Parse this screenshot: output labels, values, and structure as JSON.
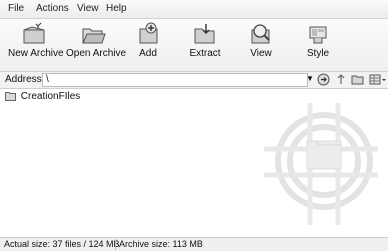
{
  "menu": [
    "File",
    "Actions",
    "View",
    "Help"
  ],
  "toolbar": {
    "new_archive": "New Archive",
    "open_archive": "Open Archive",
    "add": "Add",
    "extract": "Extract",
    "view": "View",
    "style": "Style"
  },
  "address": {
    "label": "Address",
    "value": "\\"
  },
  "tree": {
    "folder": "CreationFIles"
  },
  "status": {
    "actual": "Actual size: 37 files / 124 MB",
    "archive": "Archive size: 113 MB"
  },
  "icons": [
    "new-archive-icon",
    "open-archive-icon",
    "add-icon",
    "extract-icon",
    "view-icon",
    "style-icon",
    "go-icon",
    "up-icon",
    "folder-icon",
    "views-icon",
    "folder-icon",
    "watermark-logo"
  ]
}
